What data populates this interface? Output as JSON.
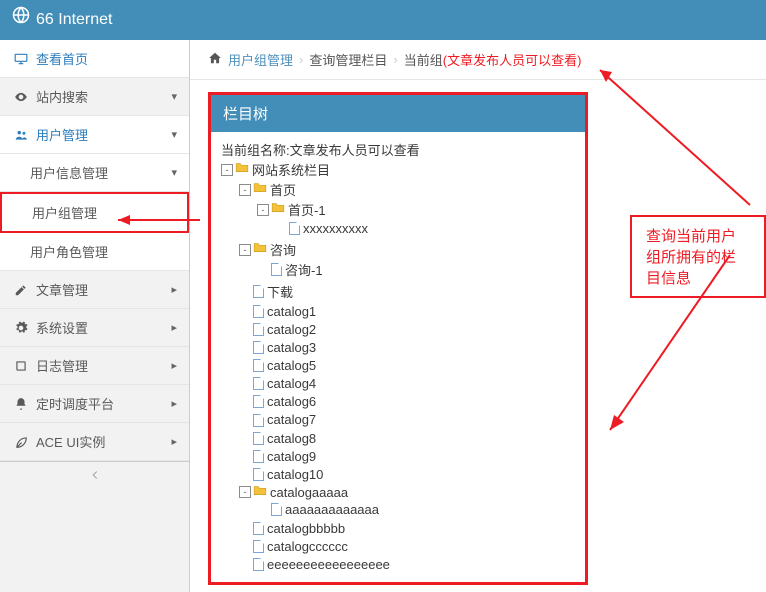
{
  "header": {
    "title": "66 Internet"
  },
  "sidebar": {
    "items": [
      {
        "label": "查看首页",
        "icon": "monitor",
        "active": true
      },
      {
        "label": "站内搜索",
        "icon": "eye",
        "chev": "down"
      },
      {
        "label": "用户管理",
        "icon": "users",
        "chev": "down",
        "active": true,
        "children": [
          {
            "label": "用户信息管理",
            "chev": "down"
          },
          {
            "label": "用户组管理",
            "highlight": true
          },
          {
            "label": "用户角色管理"
          }
        ]
      },
      {
        "label": "文章管理",
        "icon": "edit",
        "chev": "right"
      },
      {
        "label": "系统设置",
        "icon": "gear",
        "chev": "right"
      },
      {
        "label": "日志管理",
        "icon": "book",
        "chev": "right"
      },
      {
        "label": "定时调度平台",
        "icon": "bell",
        "chev": "right"
      },
      {
        "label": "ACE UI实例",
        "icon": "leaf",
        "chev": "right"
      }
    ]
  },
  "breadcrumb": {
    "home_icon": "home",
    "items": [
      "用户组管理",
      "查询管理栏目"
    ],
    "current_prefix": "当前组",
    "current_value": "文章发布人员可以查看"
  },
  "panel": {
    "title": "栏目树",
    "group_label": "当前组名称:",
    "group_name": "文章发布人员可以查看",
    "tree": {
      "root": {
        "label": "网站系统栏目",
        "type": "folder"
      },
      "children": [
        {
          "label": "首页",
          "type": "folder",
          "children": [
            {
              "label": "首页-1",
              "type": "folder",
              "children": [
                {
                  "label": "xxxxxxxxxx",
                  "type": "file"
                }
              ]
            }
          ]
        },
        {
          "label": "咨询",
          "type": "folder",
          "children": [
            {
              "label": "咨询-1",
              "type": "file"
            }
          ]
        },
        {
          "label": "下载",
          "type": "file"
        },
        {
          "label": "catalog1",
          "type": "file"
        },
        {
          "label": "catalog2",
          "type": "file"
        },
        {
          "label": "catalog3",
          "type": "file"
        },
        {
          "label": "catalog5",
          "type": "file"
        },
        {
          "label": "catalog4",
          "type": "file"
        },
        {
          "label": "catalog6",
          "type": "file"
        },
        {
          "label": "catalog7",
          "type": "file"
        },
        {
          "label": "catalog8",
          "type": "file"
        },
        {
          "label": "catalog9",
          "type": "file"
        },
        {
          "label": "catalog10",
          "type": "file"
        },
        {
          "label": "catalogaaaaa",
          "type": "folder",
          "children": [
            {
              "label": "aaaaaaaaaaaaa",
              "type": "file"
            }
          ]
        },
        {
          "label": "catalogbbbbb",
          "type": "file"
        },
        {
          "label": "catalogcccccc",
          "type": "file"
        },
        {
          "label": "eeeeeeeeeeeeeeeee",
          "type": "file"
        }
      ]
    }
  },
  "callout": {
    "text": "查询当前用户组所拥有的栏目信息"
  }
}
